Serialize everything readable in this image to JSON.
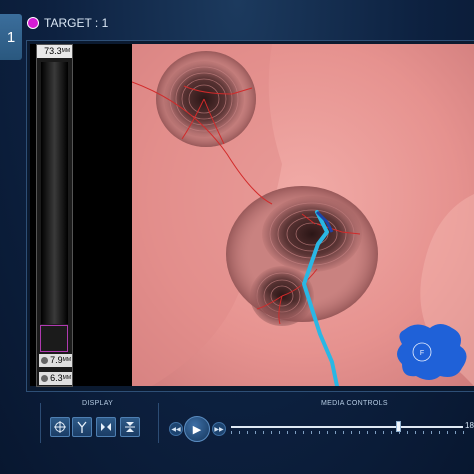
{
  "step": {
    "number": "1"
  },
  "target": {
    "label": "TARGET : 1",
    "color": "#d41cd4"
  },
  "gauge": {
    "max_value": "73.3",
    "max_unit": "MM",
    "readings": [
      {
        "value": "7.9",
        "unit": "MM"
      },
      {
        "value": "6.3",
        "unit": "MM"
      }
    ]
  },
  "endoscopic_view": {
    "tissue_color": "#e79a98",
    "path_color": "#38c0e8",
    "nav_badge": {
      "letter": "F"
    }
  },
  "toolbar": {
    "display": {
      "label": "DISPLAY",
      "buttons": [
        {
          "icon": "crosshair-icon"
        },
        {
          "icon": "branch-icon"
        },
        {
          "icon": "collapse-horizontal-icon"
        },
        {
          "icon": "collapse-vertical-icon"
        }
      ]
    },
    "media": {
      "label": "MEDIA CONTROLS",
      "frame_number": "18",
      "progress": 0.72
    }
  }
}
